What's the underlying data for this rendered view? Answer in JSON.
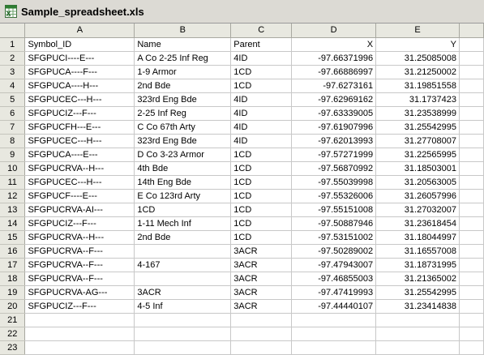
{
  "window": {
    "title": "Sample_spreadsheet.xls",
    "icon": "excel-workbook-icon"
  },
  "columns": [
    "A",
    "B",
    "C",
    "D",
    "E"
  ],
  "rows": [
    {
      "num": "1",
      "cells": [
        "Symbol_ID",
        "Name",
        "Parent",
        "X",
        "Y"
      ]
    },
    {
      "num": "2",
      "cells": [
        "SFGPUCI----E---",
        "A Co 2-25 Inf Reg",
        "4ID",
        "-97.66371996",
        "31.25085008"
      ]
    },
    {
      "num": "3",
      "cells": [
        "SFGPUCA----F---",
        "1-9 Armor",
        "1CD",
        "-97.66886997",
        "31.21250002"
      ]
    },
    {
      "num": "4",
      "cells": [
        "SFGPUCA----H---",
        "2nd Bde",
        "1CD",
        "-97.6273161",
        "31.19851558"
      ]
    },
    {
      "num": "5",
      "cells": [
        "SFGPUCEC---H---",
        "323rd Eng Bde",
        "4ID",
        "-97.62969162",
        "31.1737423"
      ]
    },
    {
      "num": "6",
      "cells": [
        "SFGPUCIZ---F---",
        "2-25 Inf Reg",
        "4ID",
        "-97.63339005",
        "31.23538999"
      ]
    },
    {
      "num": "7",
      "cells": [
        "SFGPUCFH---E---",
        "C Co 67th Arty",
        "4ID",
        "-97.61907996",
        "31.25542995"
      ]
    },
    {
      "num": "8",
      "cells": [
        "SFGPUCEC---H---",
        "323rd Eng Bde",
        "4ID",
        "-97.62013993",
        "31.27708007"
      ]
    },
    {
      "num": "9",
      "cells": [
        "SFGPUCA----E---",
        "D Co 3-23 Armor",
        "1CD",
        "-97.57271999",
        "31.22565995"
      ]
    },
    {
      "num": "10",
      "cells": [
        "SFGPUCRVA--H---",
        "4th Bde",
        "1CD",
        "-97.56870992",
        "31.18503001"
      ]
    },
    {
      "num": "11",
      "cells": [
        "SFGPUCEC---H---",
        "14th Eng Bde",
        "1CD",
        "-97.55039998",
        "31.20563005"
      ]
    },
    {
      "num": "12",
      "cells": [
        "SFGPUCF----E---",
        "E Co 123rd Arty",
        "1CD",
        "-97.55326006",
        "31.26057996"
      ]
    },
    {
      "num": "13",
      "cells": [
        "SFGPUCRVA-AI---",
        "1CD",
        "1CD",
        "-97.55151008",
        "31.27032007"
      ]
    },
    {
      "num": "14",
      "cells": [
        "SFGPUCIZ---F---",
        "1-11 Mech Inf",
        "1CD",
        "-97.50887946",
        "31.23618454"
      ]
    },
    {
      "num": "15",
      "cells": [
        "SFGPUCRVA--H---",
        "2nd Bde",
        "1CD",
        "-97.53151002",
        "31.18044997"
      ]
    },
    {
      "num": "16",
      "cells": [
        "SFGPUCRVA--F---",
        "",
        "3ACR",
        "-97.50289002",
        "31.16557008"
      ]
    },
    {
      "num": "17",
      "cells": [
        "SFGPUCRVA--F---",
        "4-167",
        "3ACR",
        "-97.47943007",
        "31.18731995"
      ]
    },
    {
      "num": "18",
      "cells": [
        "SFGPUCRVA--F---",
        "",
        "3ACR",
        "-97.46855003",
        "31.21365002"
      ]
    },
    {
      "num": "19",
      "cells": [
        "SFGPUCRVA-AG---",
        "3ACR",
        "3ACR",
        "-97.47419993",
        "31.25542995"
      ]
    },
    {
      "num": "20",
      "cells": [
        "SFGPUCIZ---F---",
        "4-5 Inf",
        "3ACR",
        "-97.44440107",
        "31.23414838"
      ]
    },
    {
      "num": "21",
      "cells": [
        "",
        "",
        "",
        "",
        ""
      ]
    },
    {
      "num": "22",
      "cells": [
        "",
        "",
        "",
        "",
        ""
      ]
    },
    {
      "num": "23",
      "cells": [
        "",
        "",
        "",
        "",
        ""
      ]
    }
  ]
}
